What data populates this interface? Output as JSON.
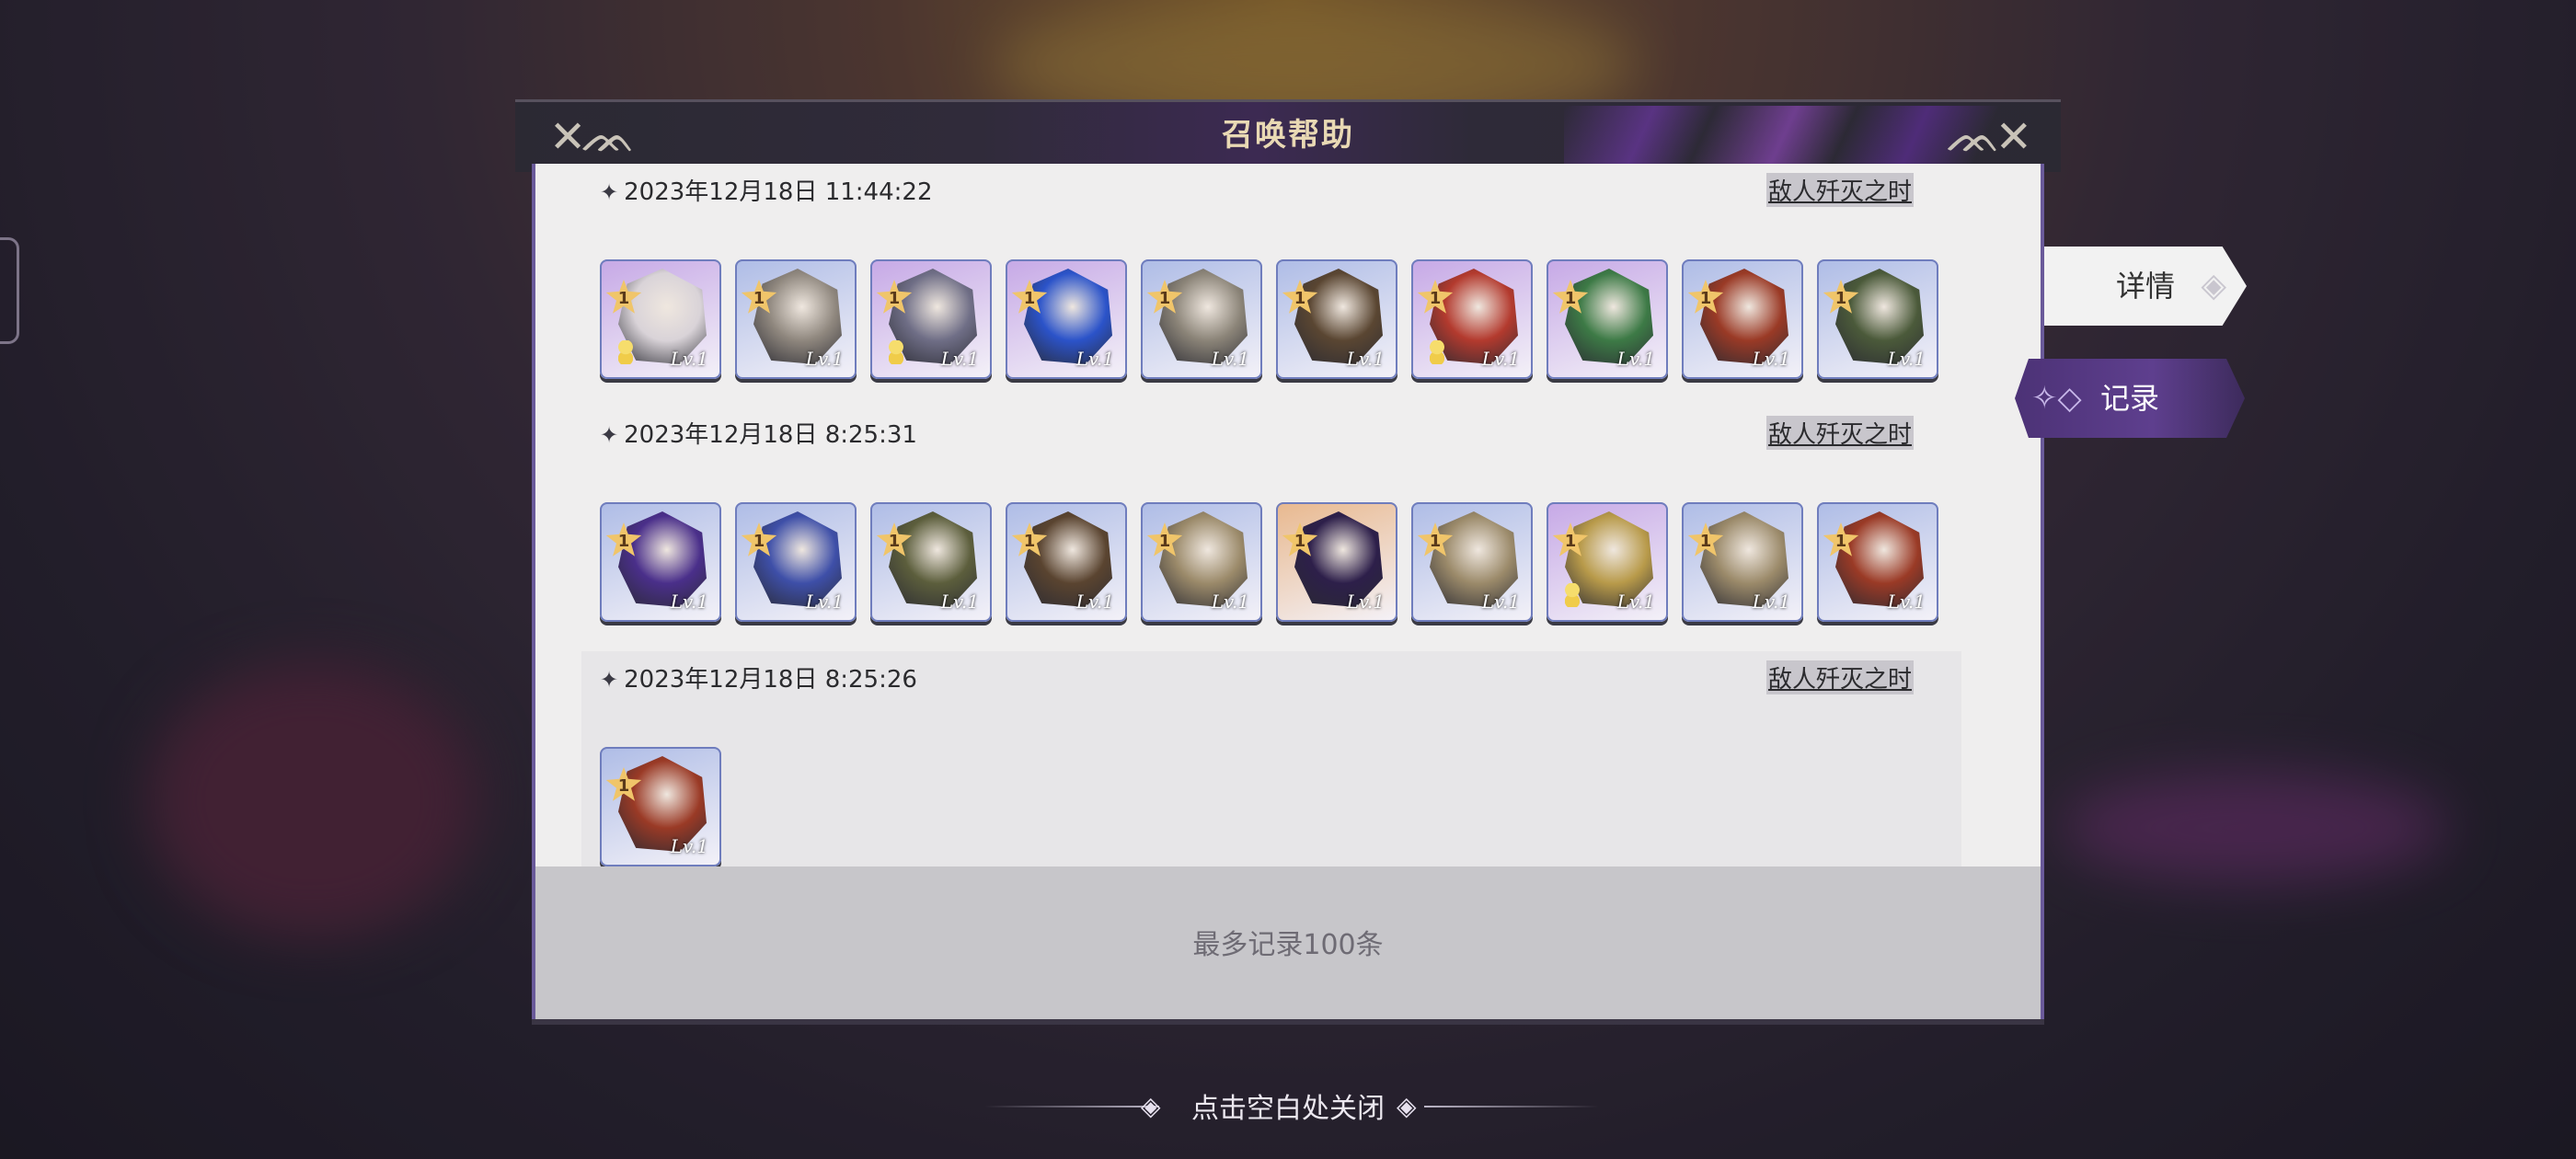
{
  "dialog": {
    "title": "召唤帮助",
    "footer_note": "最多记录100条",
    "close_hint": "点击空白处关闭"
  },
  "tabs": [
    {
      "label": "详情",
      "active": false
    },
    {
      "label": "记录",
      "active": true
    }
  ],
  "records": [
    {
      "datetime": "2023年12月18日  11:44:22",
      "result": "敌人歼灭之时",
      "cards": [
        {
          "rank": "1",
          "level": "Lv.1",
          "frame": "purple",
          "coin": true,
          "art": "#d9d3d8"
        },
        {
          "rank": "1",
          "level": "Lv.1",
          "frame": "blue",
          "coin": false,
          "art": "#8f877e"
        },
        {
          "rank": "1",
          "level": "Lv.1",
          "frame": "purple",
          "coin": true,
          "art": "#6f6e86"
        },
        {
          "rank": "1",
          "level": "Lv.1",
          "frame": "purple",
          "coin": false,
          "art": "#2b53c9"
        },
        {
          "rank": "1",
          "level": "Lv.1",
          "frame": "blue",
          "coin": false,
          "art": "#8b8478"
        },
        {
          "rank": "1",
          "level": "Lv.1",
          "frame": "blue",
          "coin": false,
          "art": "#5a4632"
        },
        {
          "rank": "1",
          "level": "Lv.1",
          "frame": "purple",
          "coin": true,
          "art": "#b33a2e"
        },
        {
          "rank": "1",
          "level": "Lv.1",
          "frame": "purple",
          "coin": false,
          "art": "#3d7a46"
        },
        {
          "rank": "1",
          "level": "Lv.1",
          "frame": "blue",
          "coin": false,
          "art": "#9a3a26"
        },
        {
          "rank": "1",
          "level": "Lv.1",
          "frame": "blue",
          "coin": false,
          "art": "#4b5a3a"
        }
      ]
    },
    {
      "datetime": "2023年12月18日  8:25:31",
      "result": "敌人歼灭之时",
      "cards": [
        {
          "rank": "1",
          "level": "Lv.1",
          "frame": "blue",
          "coin": false,
          "art": "#4a2f8a"
        },
        {
          "rank": "1",
          "level": "Lv.1",
          "frame": "blue",
          "coin": false,
          "art": "#3e4fa8"
        },
        {
          "rank": "1",
          "level": "Lv.1",
          "frame": "blue",
          "coin": false,
          "art": "#5c5e3c"
        },
        {
          "rank": "1",
          "level": "Lv.1",
          "frame": "blue",
          "coin": false,
          "art": "#5a4430"
        },
        {
          "rank": "1",
          "level": "Lv.1",
          "frame": "blue",
          "coin": false,
          "art": "#9b8a6a"
        },
        {
          "rank": "1",
          "level": "Lv.1",
          "frame": "orange",
          "coin": false,
          "art": "#2d1f4a"
        },
        {
          "rank": "1",
          "level": "Lv.1",
          "frame": "blue",
          "coin": false,
          "art": "#9b8a6a"
        },
        {
          "rank": "1",
          "level": "Lv.1",
          "frame": "purple",
          "coin": true,
          "art": "#b89a4a"
        },
        {
          "rank": "1",
          "level": "Lv.1",
          "frame": "blue",
          "coin": false,
          "art": "#9b8a6a"
        },
        {
          "rank": "1",
          "level": "Lv.1",
          "frame": "blue",
          "coin": false,
          "art": "#9a3a26"
        }
      ]
    },
    {
      "datetime": "2023年12月18日  8:25:26",
      "result": "敌人歼灭之时",
      "cards": [
        {
          "rank": "1",
          "level": "Lv.1",
          "frame": "blue",
          "coin": false,
          "art": "#9a3a26"
        }
      ]
    }
  ],
  "colors": {
    "frame_blue": "#aebce6",
    "frame_purple": "#c6a8e6",
    "frame_orange": "#e8b88e",
    "accent_purple": "#5e3f8e"
  }
}
